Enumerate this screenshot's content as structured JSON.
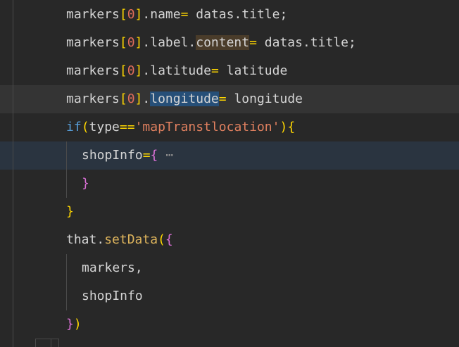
{
  "lines": [
    {
      "id": "l1",
      "parts": [
        {
          "c": "t",
          "v": "markers"
        },
        {
          "c": "br1",
          "v": "["
        },
        {
          "c": "num",
          "v": "0"
        },
        {
          "c": "br1",
          "v": "]"
        },
        {
          "c": "t",
          "v": ".name"
        },
        {
          "c": "op",
          "v": "="
        },
        {
          "c": "t",
          "v": " datas.title;"
        }
      ]
    },
    {
      "id": "l2",
      "parts": [
        {
          "c": "t",
          "v": "markers"
        },
        {
          "c": "br1",
          "v": "["
        },
        {
          "c": "num",
          "v": "0"
        },
        {
          "c": "br1",
          "v": "]"
        },
        {
          "c": "t",
          "v": ".label."
        },
        {
          "c": "t hl-word",
          "v": "content"
        },
        {
          "c": "op",
          "v": "="
        },
        {
          "c": "t",
          "v": " datas.title;"
        }
      ]
    },
    {
      "id": "l3",
      "parts": [
        {
          "c": "t",
          "v": "markers"
        },
        {
          "c": "br1",
          "v": "["
        },
        {
          "c": "num",
          "v": "0"
        },
        {
          "c": "br1",
          "v": "]"
        },
        {
          "c": "t",
          "v": ".latitude"
        },
        {
          "c": "op",
          "v": "="
        },
        {
          "c": "t",
          "v": " latitude"
        }
      ]
    },
    {
      "id": "l4",
      "parts": [
        {
          "c": "t",
          "v": "markers"
        },
        {
          "c": "br1",
          "v": "["
        },
        {
          "c": "num",
          "v": "0"
        },
        {
          "c": "br1",
          "v": "]"
        },
        {
          "c": "t",
          "v": "."
        },
        {
          "c": "t hl-sel",
          "v": "longitude"
        },
        {
          "c": "op",
          "v": "="
        },
        {
          "c": "t",
          "v": " longitude"
        }
      ]
    },
    {
      "id": "l5",
      "parts": [
        {
          "c": "kw",
          "v": "if"
        },
        {
          "c": "br1",
          "v": "("
        },
        {
          "c": "t",
          "v": "type"
        },
        {
          "c": "op",
          "v": "=="
        },
        {
          "c": "str",
          "v": "'mapTranstlocation'"
        },
        {
          "c": "br1",
          "v": ")"
        },
        {
          "c": "br1",
          "v": "{"
        }
      ]
    },
    {
      "id": "l6",
      "parts": [
        {
          "c": "t",
          "v": "shopInfo"
        },
        {
          "c": "op",
          "v": "="
        },
        {
          "c": "br2",
          "v": "{"
        },
        {
          "c": "fold",
          "v": " ⋯"
        }
      ]
    },
    {
      "id": "l7",
      "parts": [
        {
          "c": "br2",
          "v": "}"
        }
      ]
    },
    {
      "id": "l8",
      "parts": [
        {
          "c": "br1",
          "v": "}"
        }
      ]
    },
    {
      "id": "l9",
      "parts": [
        {
          "c": "t",
          "v": "that."
        },
        {
          "c": "fn",
          "v": "setData"
        },
        {
          "c": "br1",
          "v": "("
        },
        {
          "c": "br2",
          "v": "{"
        }
      ]
    },
    {
      "id": "l10",
      "parts": [
        {
          "c": "t",
          "v": "markers,"
        }
      ]
    },
    {
      "id": "l11",
      "parts": [
        {
          "c": "t",
          "v": "shopInfo"
        }
      ]
    },
    {
      "id": "l12",
      "parts": [
        {
          "c": "br2",
          "v": "}"
        },
        {
          "c": "br1",
          "v": ")"
        }
      ]
    }
  ],
  "colors": {
    "background": "#282828",
    "text": "#d4d4d4",
    "number": "#e06c5a",
    "operator": "#ffd700",
    "keyword": "#569cd6",
    "function": "#dcb35c",
    "string": "#e0805f",
    "bracket_outer": "#ffd700",
    "bracket_inner": "#da70d6",
    "word_highlight": "#4a3c2a",
    "selection": "#264f78"
  }
}
